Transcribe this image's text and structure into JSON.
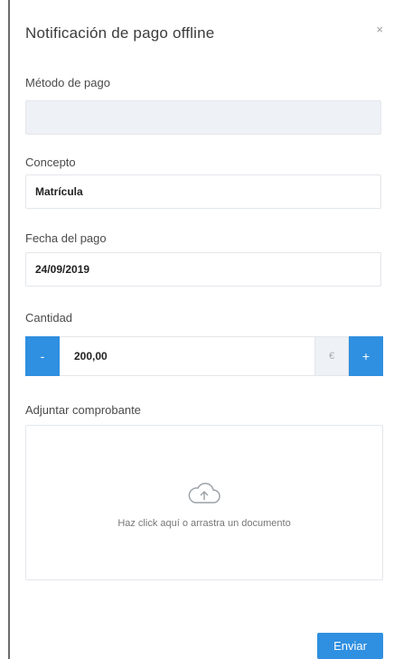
{
  "modal": {
    "title": "Notificación de pago offline",
    "close_label": "×"
  },
  "form": {
    "payment_method": {
      "label": "Método de pago",
      "value": ""
    },
    "concept": {
      "label": "Concepto",
      "value": "Matrícula"
    },
    "payment_date": {
      "label": "Fecha del pago",
      "value": "24/09/2019"
    },
    "amount": {
      "label": "Cantidad",
      "value": "200,00",
      "currency": "€",
      "decrement_label": "-",
      "increment_label": "+"
    },
    "attachment": {
      "label": "Adjuntar comprobante",
      "dropzone_text": "Haz click aquí o arrastra un documento",
      "icon": "cloud-upload-icon"
    }
  },
  "actions": {
    "submit_label": "Enviar"
  },
  "colors": {
    "accent": "#2f8fe0",
    "disabled_bg": "#eef1f5",
    "border": "#e3e6ea"
  }
}
